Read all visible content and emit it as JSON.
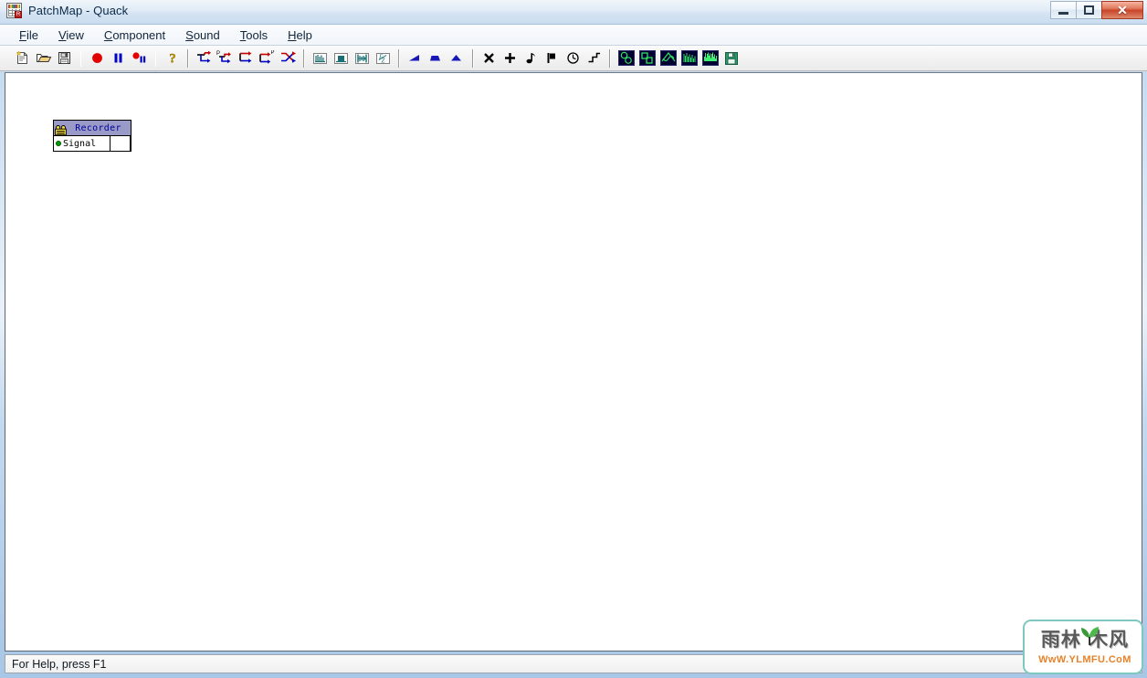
{
  "window": {
    "title": "PatchMap - Quack",
    "app_icon": "patchmap-app-icon",
    "buttons": {
      "minimize": "minimize-button",
      "maximize": "maximize-button",
      "close": "close-button",
      "close_glyph": "✕"
    }
  },
  "menubar": {
    "items": [
      {
        "label": "File",
        "accel": "F",
        "rest": "ile"
      },
      {
        "label": "View",
        "accel": "V",
        "rest": "iew"
      },
      {
        "label": "Component",
        "accel": "C",
        "rest": "omponent"
      },
      {
        "label": "Sound",
        "accel": "S",
        "rest": "ound"
      },
      {
        "label": "Tools",
        "accel": "T",
        "rest": "ools"
      },
      {
        "label": "Help",
        "accel": "H",
        "rest": "elp"
      }
    ]
  },
  "toolbar": {
    "groups": [
      {
        "name": "file-group",
        "buttons": [
          {
            "icon": "new-document-icon",
            "label": "New"
          },
          {
            "icon": "open-folder-icon",
            "label": "Open"
          },
          {
            "icon": "save-disk-icon",
            "label": "Save"
          }
        ]
      },
      {
        "name": "transport-group",
        "buttons": [
          {
            "icon": "record-icon",
            "label": "Record"
          },
          {
            "icon": "pause-icon",
            "label": "Pause"
          },
          {
            "icon": "record-pause-icon",
            "label": "Record Pause"
          }
        ]
      },
      {
        "name": "help-group",
        "buttons": [
          {
            "icon": "context-help-icon",
            "label": "Help"
          }
        ]
      },
      {
        "name": "connection-group",
        "buttons": [
          {
            "icon": "connect-in-icon",
            "label": "Connect Input"
          },
          {
            "icon": "connect-in-param-icon",
            "label": "Connect Input Parameter"
          },
          {
            "icon": "connect-out-icon",
            "label": "Connect Output"
          },
          {
            "icon": "connect-out-param-icon",
            "label": "Connect Output Parameter"
          },
          {
            "icon": "cross-connect-icon",
            "label": "Cross Connect"
          }
        ]
      },
      {
        "name": "analysis-group",
        "buttons": [
          {
            "icon": "spectrum-bars-icon",
            "label": "Spectrum"
          },
          {
            "icon": "level-meter-icon",
            "label": "Level"
          },
          {
            "icon": "waveform-span-icon",
            "label": "Waveform"
          },
          {
            "icon": "formula-icon",
            "label": "Formula"
          }
        ]
      },
      {
        "name": "envelope-group",
        "buttons": [
          {
            "icon": "ramp-up-icon",
            "label": "Ramp Up"
          },
          {
            "icon": "ramp-trapezoid-icon",
            "label": "Trapezoid"
          },
          {
            "icon": "ramp-triangle-icon",
            "label": "Triangle"
          }
        ]
      },
      {
        "name": "operator-group",
        "buttons": [
          {
            "icon": "multiply-icon",
            "label": "Multiply"
          },
          {
            "icon": "add-icon",
            "label": "Add"
          },
          {
            "icon": "note-icon",
            "label": "Note"
          },
          {
            "icon": "marker-icon",
            "label": "Marker"
          },
          {
            "icon": "clock-icon",
            "label": "Clock"
          },
          {
            "icon": "step-icon",
            "label": "Step"
          }
        ]
      },
      {
        "name": "scope-group",
        "buttons": [
          {
            "icon": "xy-scope-icon",
            "label": "XY Scope"
          },
          {
            "icon": "blocks-scope-icon",
            "label": "Blocks"
          },
          {
            "icon": "sine-scope-icon",
            "label": "Sine Scope"
          },
          {
            "icon": "bars-scope-icon",
            "label": "Bars Scope"
          },
          {
            "icon": "spectrum-scope-icon",
            "label": "Spectrum Scope"
          },
          {
            "icon": "save-green-icon",
            "label": "Save Data"
          }
        ]
      }
    ]
  },
  "canvas": {
    "nodes": [
      {
        "id": "recorder",
        "title": "Recorder",
        "icon": "recorder-icon",
        "header_color": "#9a9ac8",
        "title_color": "#00009a",
        "ports": [
          {
            "label": "Signal",
            "dot_color": "#00a000",
            "kind": "input"
          },
          {
            "label": "",
            "dot_color": "",
            "kind": "empty"
          }
        ]
      }
    ]
  },
  "statusbar": {
    "text": "For Help, press F1"
  },
  "watermark": {
    "chars": "雨林 木风",
    "url": "WwW.YLMFU.CoM",
    "border_color": "#7ec8c0",
    "url_color": "#e8822a"
  }
}
